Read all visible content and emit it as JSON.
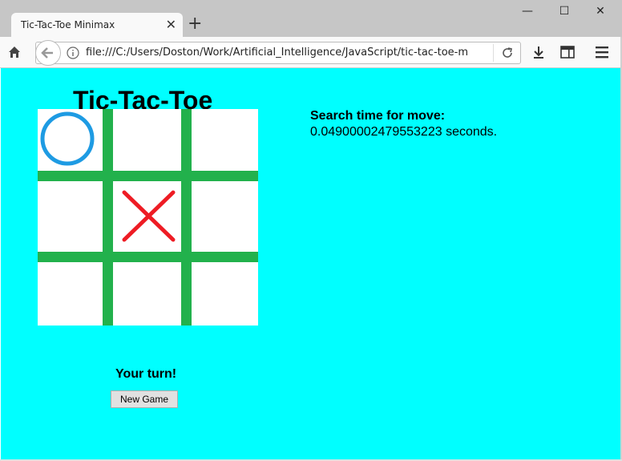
{
  "browser": {
    "tab_title": "Tic-Tac-Toe Minimax",
    "tab_close": "✕",
    "new_tab": "+",
    "minimize": "—",
    "maximize": "☐",
    "close": "✕",
    "url": "file:///C:/Users/Doston/Work/Artificial_Intelligence/JavaScript/tic-tac-toe-minimax"
  },
  "game": {
    "title": "Tic-Tac-Toe",
    "board": [
      "O",
      "",
      "",
      "",
      "X",
      "",
      "",
      "",
      ""
    ],
    "colors": {
      "o": "#1e9be3",
      "x": "#ee1c24",
      "grid": "#22b14c",
      "background": "#00ffff"
    },
    "search_label": "Search time for move:",
    "search_value": "0.04900002479553223 seconds.",
    "turn_text": "Your turn!",
    "new_game_label": "New Game"
  }
}
